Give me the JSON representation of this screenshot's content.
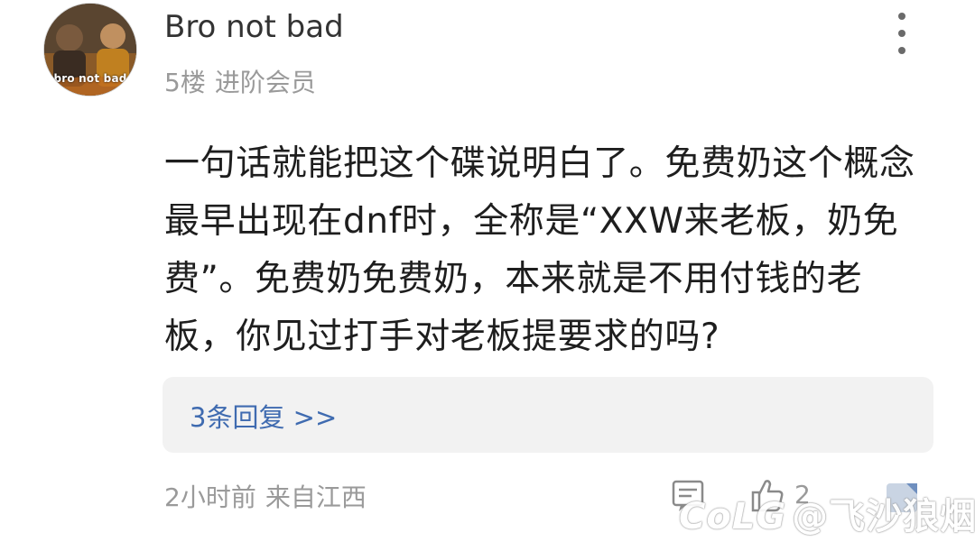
{
  "post": {
    "author": {
      "name": "Bro not bad",
      "avatar_text": "bro not bad"
    },
    "floor": "5楼",
    "rank": "进阶会员",
    "body_lines": [
      "一句话就能把这个碟说明白了。免费奶这个概念",
      "最早出现在dnf时，全称是“XXW来老板，奶免",
      "费”。免费奶免费奶，本来就是不用付钱的老",
      "板，你见过打手对老板提要求的吗?"
    ],
    "replies_link": "3条回复 >>",
    "time": "2小时前",
    "location": "来自江西",
    "likes": "2",
    "icons": {
      "more": "more-vertical-icon",
      "reply": "comment-icon",
      "like": "thumbs-up-icon",
      "share": "share-icon"
    }
  },
  "watermark": {
    "logo": "CoLG",
    "text": "@飞沙狼烟"
  },
  "colors": {
    "link": "#3f6bb0",
    "meta": "#9a9a9a",
    "reply_box_bg": "#f2f2f2"
  }
}
